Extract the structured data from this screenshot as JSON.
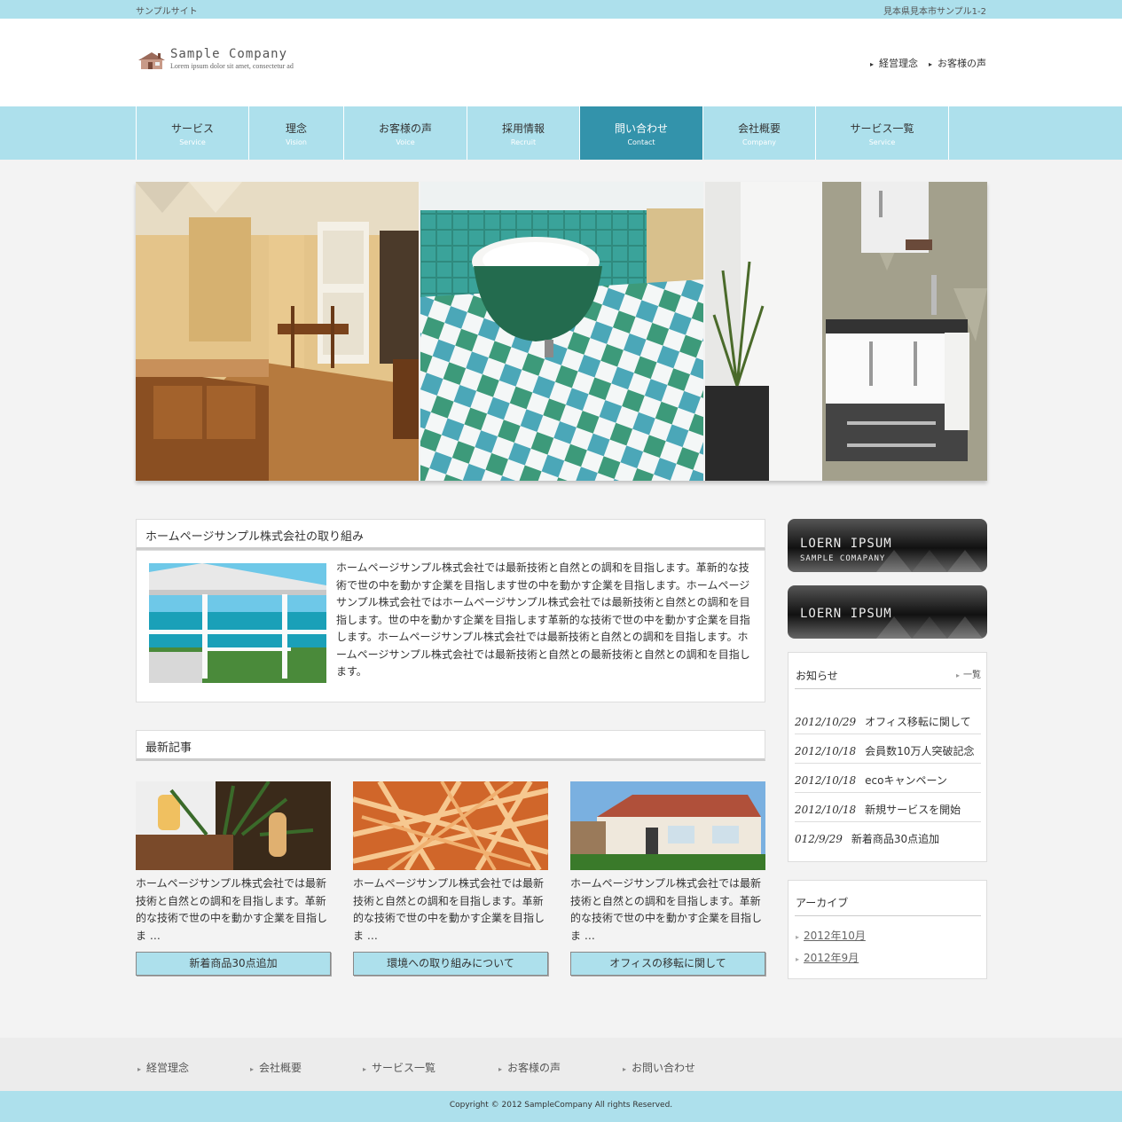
{
  "topbar": {
    "site_label": "サンプルサイト",
    "address": "見本県見本市サンプル1-2"
  },
  "logo": {
    "title": "Sample Company",
    "subtitle": "Lorem ipsum dolor sit amet, consectetur ad"
  },
  "header_links": [
    "経営理念",
    "お客様の声"
  ],
  "nav": [
    {
      "jp": "サービス",
      "en": "Service"
    },
    {
      "jp": "理念",
      "en": "Vision"
    },
    {
      "jp": "お客様の声",
      "en": "Voice"
    },
    {
      "jp": "採用情報",
      "en": "Recruit"
    },
    {
      "jp": "問い合わせ",
      "en": "Contact",
      "active": true
    },
    {
      "jp": "会社概要",
      "en": "Company"
    },
    {
      "jp": "サービス一覧",
      "en": "Service"
    }
  ],
  "intro": {
    "heading": "ホームページサンプル株式会社の取り組み",
    "text": "ホームページサンプル株式会社では最新技術と自然との調和を目指します。革新的な技術で世の中を動かす企業を目指します世の中を動かす企業を目指します。ホームページサンプル株式会社ではホームページサンプル株式会社では最新技術と自然との調和を目指します。世の中を動かす企業を目指します革新的な技術で世の中を動かす企業を目指します。ホームページサンプル株式会社では最新技術と自然との調和を目指します。ホームページサンプル株式会社では最新技術と自然との最新技術と自然との調和を目指します。"
  },
  "latest": {
    "heading": "最新記事",
    "articles": [
      {
        "text": "ホームページサンプル株式会社では最新技術と自然との調和を目指します。革新的な技術で世の中を動かす企業を目指しま …",
        "button": "新着商品30点追加"
      },
      {
        "text": "ホームページサンプル株式会社では最新技術と自然との調和を目指します。革新的な技術で世の中を動かす企業を目指しま …",
        "button": "環境への取り組みについて"
      },
      {
        "text": "ホームページサンプル株式会社では最新技術と自然との調和を目指します。革新的な技術で世の中を動かす企業を目指しま …",
        "button": "オフィスの移転に関して"
      }
    ]
  },
  "banners": [
    {
      "title": "LOERN IPSUM",
      "subtitle": "SAMPLE COMAPANY"
    },
    {
      "title": "LOERN IPSUM"
    }
  ],
  "news": {
    "heading": "お知らせ",
    "more": "一覧",
    "items": [
      {
        "date": "2012/10/29",
        "title": "オフィス移転に関して"
      },
      {
        "date": "2012/10/18",
        "title": "会員数10万人突破記念"
      },
      {
        "date": "2012/10/18",
        "title": "ecoキャンペーン"
      },
      {
        "date": "2012/10/18",
        "title": "新規サービスを開始"
      },
      {
        "date": "012/9/29",
        "title": "新着商品30点追加"
      }
    ]
  },
  "archive": {
    "heading": "アーカイブ",
    "items": [
      "2012年10月",
      "2012年9月"
    ]
  },
  "footer_nav": [
    "経営理念",
    "会社概要",
    "サービス一覧",
    "お客様の声",
    "お問い合わせ"
  ],
  "copyright": "Copyright © 2012 SampleCompany All rights Reserved.",
  "colors": {
    "accent": "#ade0ec",
    "active_nav": "#3393ab",
    "background": "#f3f3f3"
  }
}
